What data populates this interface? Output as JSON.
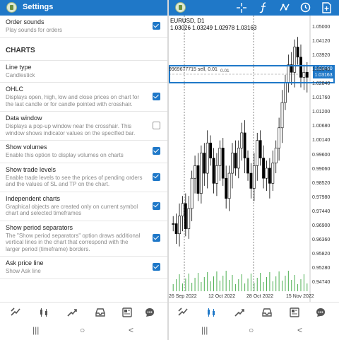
{
  "left": {
    "title": "Settings",
    "rows_top": [
      {
        "title": "Order sounds",
        "desc": "Play sounds for orders",
        "checked": true
      }
    ],
    "section": "CHARTS",
    "rows": [
      {
        "title": "Line type",
        "desc": "Candlestick",
        "checked": null
      },
      {
        "title": "OHLC",
        "desc": "Displays open, high, low and close prices on chart for the last candle or for candle pointed with crosshair.",
        "checked": true
      },
      {
        "title": "Data window",
        "desc": "Displays a pop-up window near the crosshair. This window shows indicator values on the specified bar.",
        "checked": false
      },
      {
        "title": "Show volumes",
        "desc": "Enable this option to display volumes on charts",
        "checked": true
      },
      {
        "title": "Show trade levels",
        "desc": "Enable trade levels to see the prices of pending orders and the values of SL and TP on the chart.",
        "checked": true
      },
      {
        "title": "Independent charts",
        "desc": "Graphical objects are created only on current symbol chart and selected timeframes",
        "checked": true
      },
      {
        "title": "Show period separators",
        "desc": "The \"Show period separators\" option draws additional vertical lines in the chart that correspond with the larger period (timeframe) borders.",
        "checked": true
      },
      {
        "title": "Ask price line",
        "desc": "Show Ask line",
        "checked": true
      }
    ],
    "bottom_icons": [
      "quotes-icon",
      "chart-icon",
      "trade-icon",
      "history-icon",
      "news-icon",
      "chat-icon"
    ]
  },
  "right": {
    "toolbar_icons": [
      "crosshair-icon",
      "indicators-icon",
      "objects-icon",
      "timeframe-icon",
      "new-order-icon"
    ],
    "symbol": "EURUSD, D1",
    "ohlc_values": "1.03026 1.03249 1.02978 1.03163",
    "trade_line": "9969677715 sell, 0.01",
    "trade_label": "0.01",
    "price_tags": [
      "1.03380",
      "1.03163"
    ],
    "y_labels": [
      "1.05000",
      "1.04120",
      "1.03920",
      "1.03040",
      "1.02840",
      "1.01760",
      "1.01200",
      "1.00680",
      "1.00140",
      "0.99600",
      "0.99060",
      "0.98520",
      "0.97980",
      "0.97440",
      "0.96900",
      "0.96360",
      "0.95820",
      "0.95280",
      "0.94740"
    ],
    "x_labels": [
      "26 Sep 2022",
      "12 Oct 2022",
      "28 Oct 2022",
      "15 Nov 2022"
    ],
    "bottom_icons": [
      "quotes-icon",
      "chart-icon",
      "trade-icon",
      "history-icon",
      "news-icon",
      "chat-icon"
    ]
  },
  "system_nav": {
    "recents": "|||",
    "home": "○",
    "back": "<"
  },
  "colors": {
    "accent": "#1f78c8",
    "bull": "#ffffff",
    "bear": "#000000",
    "volume": "#4caf50"
  },
  "chart_data": {
    "type": "candlestick",
    "title": "EURUSD, D1",
    "x": [
      "26 Sep 2022",
      "12 Oct 2022",
      "28 Oct 2022",
      "15 Nov 2022"
    ],
    "ylim": [
      0.9474,
      1.05
    ]
  }
}
